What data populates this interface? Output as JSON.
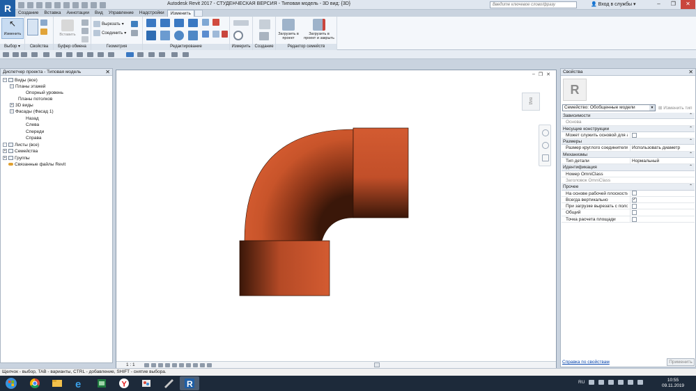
{
  "window": {
    "title": "Autodesk Revit 2017 - СТУДЕНЧЕСКАЯ ВЕРСИЯ -   Типовая модель - 3D вид: {3D}",
    "search_placeholder": "Введите ключевое слово/фразу",
    "login": "Вход в службы"
  },
  "ribbon": {
    "tabs": [
      "Создание",
      "Вставка",
      "Аннотации",
      "Вид",
      "Управление",
      "Надстройки",
      "Изменить"
    ],
    "active_tab": "Изменить",
    "modify_btn": "Изменить",
    "select_label": "Выбор ▾",
    "properties_label": "Свойства",
    "clipboard_label": "Буфер обмена",
    "paste_btn": "Вставить",
    "cut": "Вырезать",
    "join": "Соединить",
    "geometry_label": "Геометрия",
    "modify_label": "Редактирование",
    "measure_label": "Измерить",
    "create_label": "Создание",
    "load_into_project": "Загрузить в проект",
    "load_and_close": "Загрузить в проект и закрыть",
    "family_editor_label": "Редактор семейств"
  },
  "project_browser": {
    "title": "Диспетчер проекта - Типовая модель",
    "nodes": [
      {
        "label": "Виды (все)"
      },
      {
        "label": "Планы этажей"
      },
      {
        "label": "Опорный уровень"
      },
      {
        "label": "Планы потолков"
      },
      {
        "label": "3D виды"
      },
      {
        "label": "Фасады (Фасад 1)"
      },
      {
        "label": "Назад"
      },
      {
        "label": "Слева"
      },
      {
        "label": "Спереди"
      },
      {
        "label": "Справа"
      },
      {
        "label": "Листы (все)"
      },
      {
        "label": "Семейства"
      },
      {
        "label": "Группы"
      },
      {
        "label": "Связанные файлы Revit"
      }
    ]
  },
  "view": {
    "scale": "1 : 1",
    "viewcube_label": "ВИД",
    "pipe_color": "#c9552e"
  },
  "properties": {
    "title": "Свойства",
    "family": "Семейство: Обобщенные модели",
    "edit_type": "Изменить тип",
    "rows": [
      {
        "type": "group",
        "label": "Зависимости"
      },
      {
        "type": "prop",
        "key": "Основа",
        "value": "",
        "disabled": true
      },
      {
        "type": "group",
        "label": "Несущие конструкции"
      },
      {
        "type": "prop",
        "key": "Может служить основой для а...",
        "value": "checkbox-off"
      },
      {
        "type": "group",
        "label": "Размеры"
      },
      {
        "type": "prop",
        "key": "Размер круглого соединителя",
        "value": "Использовать диаметр"
      },
      {
        "type": "group",
        "label": "Механизмы"
      },
      {
        "type": "prop",
        "key": "Тип детали",
        "value": "Нормальный"
      },
      {
        "type": "group",
        "label": "Идентификация"
      },
      {
        "type": "prop",
        "key": "Номер OmniClass",
        "value": ""
      },
      {
        "type": "prop",
        "key": "Заголовок OmniClass",
        "value": "",
        "disabled": true
      },
      {
        "type": "group",
        "label": "Прочее"
      },
      {
        "type": "prop",
        "key": "На основе рабочей плоскости",
        "value": "checkbox-off"
      },
      {
        "type": "prop",
        "key": "Всегда вертикально",
        "value": "checkbox-on"
      },
      {
        "type": "prop",
        "key": "При загрузке вырезать с поло...",
        "value": "checkbox-off"
      },
      {
        "type": "prop",
        "key": "Общий",
        "value": "checkbox-off"
      },
      {
        "type": "prop",
        "key": "Точка расчета площади",
        "value": "checkbox-off"
      }
    ],
    "help_link": "Справка по свойствам",
    "apply": "Применить"
  },
  "statusbar": {
    "text": "Щелчок - выбор, TAB - варианты, CTRL - добавление, SHIFT - снятие выбора."
  },
  "taskbar": {
    "lang": "RU",
    "time": "10:55",
    "date": "09.11.2019"
  }
}
